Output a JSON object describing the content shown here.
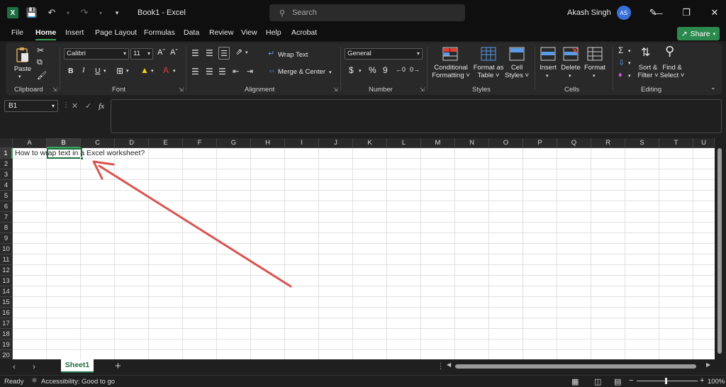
{
  "titlebar": {
    "title": "Book1  -  Excel",
    "search_placeholder": "Search",
    "user_name": "Akash Singh",
    "user_initials": "AS",
    "excel_logo": "X"
  },
  "menu": {
    "tabs": [
      "File",
      "Home",
      "Insert",
      "Page Layout",
      "Formulas",
      "Data",
      "Review",
      "View",
      "Help",
      "Acrobat"
    ],
    "share_label": "Share"
  },
  "ribbon": {
    "clipboard": {
      "paste": "Paste",
      "label": "Clipboard"
    },
    "font": {
      "name": "Calibri",
      "size": "11",
      "label": "Font",
      "bold": "B",
      "italic": "I",
      "underline": "U",
      "grow": "A^",
      "shrink": "A˅"
    },
    "alignment": {
      "wrap_text": "Wrap Text",
      "merge_center": "Merge & Center",
      "label": "Alignment"
    },
    "number": {
      "format": "General",
      "currency": "$",
      "percent": "%",
      "comma": "9",
      "label": "Number"
    },
    "styles": {
      "conditional_formatting": [
        "Conditional",
        "Formatting ˅"
      ],
      "format_as_table": [
        "Format as",
        "Table ˅"
      ],
      "cell_styles": [
        "Cell",
        "Styles ˅"
      ],
      "label": "Styles"
    },
    "cells": {
      "insert": "Insert",
      "delete": "Delete",
      "format": "Format",
      "label": "Cells"
    },
    "editing": {
      "sort_filter": [
        "Sort &",
        "Filter ˅"
      ],
      "find_select": [
        "Find &",
        "Select ˅"
      ],
      "label": "Editing"
    }
  },
  "formula_bar": {
    "name_box": "B1",
    "fx": "fx"
  },
  "grid": {
    "columns": [
      "A",
      "B",
      "C",
      "D",
      "E",
      "F",
      "G",
      "H",
      "I",
      "J",
      "K",
      "L",
      "M",
      "N",
      "O",
      "P",
      "Q",
      "R",
      "S",
      "T",
      "U"
    ],
    "rows": [
      "1",
      "2",
      "3",
      "4",
      "5",
      "6",
      "7",
      "8",
      "9",
      "10",
      "11",
      "12",
      "13",
      "14",
      "15",
      "16",
      "17",
      "18",
      "19",
      "20"
    ],
    "selected_column": "B",
    "selected_row": "1",
    "cell_a1": "How to wrap text in a Excel worksheet?"
  },
  "sheets": {
    "tabs": [
      "Sheet1"
    ],
    "add": "+"
  },
  "status": {
    "ready": "Ready",
    "accessibility": "Accessibility: Good to go",
    "zoom": "100%"
  },
  "colors": {
    "excel_green": "#1d6f42",
    "share_green": "#2d8a4e",
    "arrow_red": "#d9534f"
  }
}
